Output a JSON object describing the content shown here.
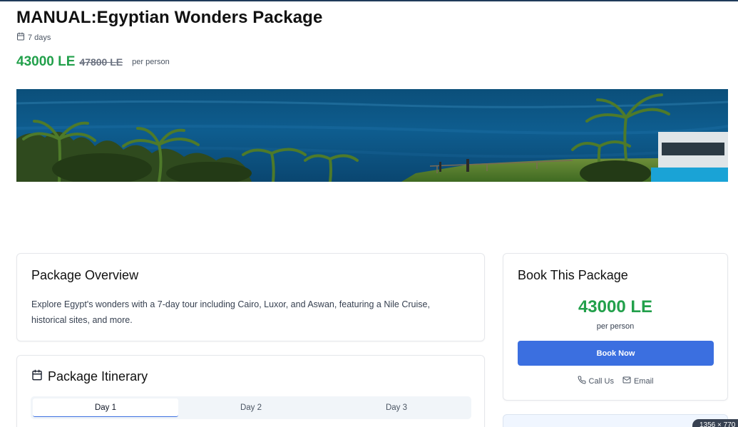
{
  "header": {
    "title": "MANUAL:Egyptian Wonders Package",
    "duration": "7 days",
    "price_current": "43000 LE",
    "price_old": "47800 LE",
    "price_per": "per person"
  },
  "hero": {
    "alt": "tropical coastline with ocean and palm trees"
  },
  "overview": {
    "title": "Package Overview",
    "description": "Explore Egypt's wonders with a 7-day tour including Cairo, Luxor, and Aswan, featuring a Nile Cruise, historical sites, and more."
  },
  "itinerary": {
    "title": "Package Itinerary",
    "tabs": [
      {
        "label": "Day 1",
        "active": true
      },
      {
        "label": "Day 2",
        "active": false
      },
      {
        "label": "Day 3",
        "active": false
      }
    ]
  },
  "booking": {
    "title": "Book This Package",
    "price": "43000 LE",
    "per": "per person",
    "button_label": "Book Now",
    "call_label": "Call Us",
    "email_label": "Email"
  },
  "overlay": {
    "size_badge": "1356 × 770"
  },
  "colors": {
    "price_green": "#22a04b",
    "primary_blue": "#3b6fe0"
  },
  "icons": [
    "calendar-icon",
    "phone-icon",
    "mail-icon"
  ]
}
